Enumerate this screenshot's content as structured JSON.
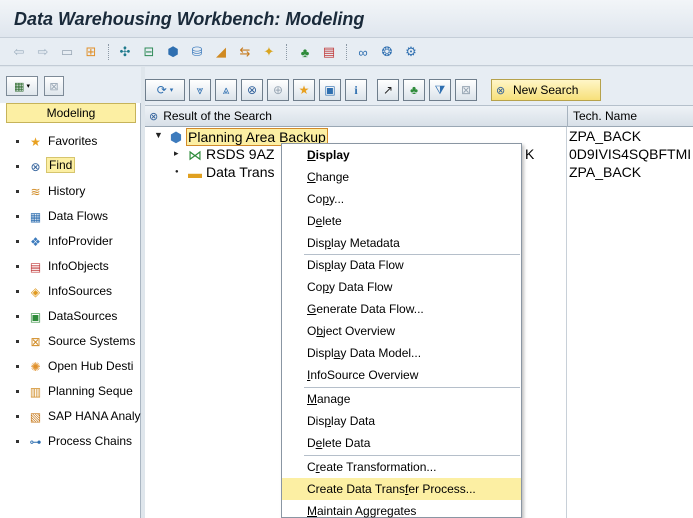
{
  "window": {
    "title": "Data Warehousing Workbench: Modeling"
  },
  "app_toolbar": {
    "icons": [
      "back-arrow-icon",
      "forward-arrow-icon",
      "display-icon",
      "hierarchy-icon",
      "network-icon",
      "object-tree-icon",
      "cube-icon",
      "database-icon",
      "ruler-icon",
      "transfer-icon",
      "magic-wand-icon",
      "tree-view-icon",
      "bookmark-icon",
      "link-icon",
      "share-icon",
      "settings-icon"
    ]
  },
  "left_pane": {
    "tab_label": "Modeling",
    "nav_items": [
      {
        "label": "Favorites",
        "icon": "star-icon",
        "selected": false
      },
      {
        "label": "Find",
        "icon": "binoculars-icon",
        "selected": true
      },
      {
        "label": "History",
        "icon": "history-icon",
        "selected": false
      },
      {
        "label": "Data Flows",
        "icon": "dataflow-icon",
        "selected": false
      },
      {
        "label": "InfoProvider",
        "icon": "infoprovider-icon",
        "selected": false
      },
      {
        "label": "InfoObjects",
        "icon": "infoobjects-icon",
        "selected": false
      },
      {
        "label": "InfoSources",
        "icon": "infosources-icon",
        "selected": false
      },
      {
        "label": "DataSources",
        "icon": "datasources-icon",
        "selected": false
      },
      {
        "label": "Source Systems",
        "icon": "source-systems-icon",
        "selected": false
      },
      {
        "label": "Open Hub Desti",
        "icon": "open-hub-icon",
        "selected": false
      },
      {
        "label": "Planning Seque",
        "icon": "planning-icon",
        "selected": false
      },
      {
        "label": "SAP HANA Analy",
        "icon": "hana-icon",
        "selected": false
      },
      {
        "label": "Process Chains",
        "icon": "process-chains-icon",
        "selected": false
      }
    ]
  },
  "right_pane": {
    "toolbar": {
      "new_search_label": "New Search"
    },
    "columns": {
      "result": "Result of the Search",
      "tech_name": "Tech. Name"
    },
    "tree": [
      {
        "label": "Planning Area Backup",
        "tech": "ZPA_BACK",
        "level": 0,
        "expanded": true,
        "icon": "cube-icon"
      },
      {
        "label": "RSDS 9AZ",
        "label_tail": "K",
        "tech": "0D9IVIS4SQBFTMI",
        "level": 1,
        "expanded": false,
        "icon": "transformation-icon"
      },
      {
        "label": "Data Trans",
        "tech": "ZPA_BACK",
        "level": 1,
        "expanded": false,
        "icon": "folder-icon"
      }
    ]
  },
  "context_menu": {
    "items": [
      {
        "label": "Display",
        "u": "D",
        "bold": true
      },
      {
        "label": "Change",
        "u": "C"
      },
      {
        "label": "Copy...",
        "u": "p"
      },
      {
        "label": "Delete",
        "u": "e"
      },
      {
        "label": "Display Metadata",
        "u": "p"
      },
      {
        "sep": true
      },
      {
        "label": "Display Data Flow",
        "u": "p"
      },
      {
        "label": "Copy Data Flow",
        "u": "p"
      },
      {
        "label": "Generate Data Flow...",
        "u": "G"
      },
      {
        "label": "Object Overview",
        "u": "b"
      },
      {
        "label": "Display Data Model...",
        "u": "a"
      },
      {
        "label": "InfoSource Overview",
        "u": "I"
      },
      {
        "sep": true
      },
      {
        "label": "Manage",
        "u": "M"
      },
      {
        "label": "Display Data",
        "u": "p"
      },
      {
        "label": "Delete Data",
        "u": "e"
      },
      {
        "sep": true
      },
      {
        "label": "Create Transformation...",
        "u": "r"
      },
      {
        "label": "Create Data Transfer Process...",
        "u": "f",
        "highlighted": true
      },
      {
        "label": "Maintain Aggregates",
        "u": "M"
      }
    ]
  }
}
